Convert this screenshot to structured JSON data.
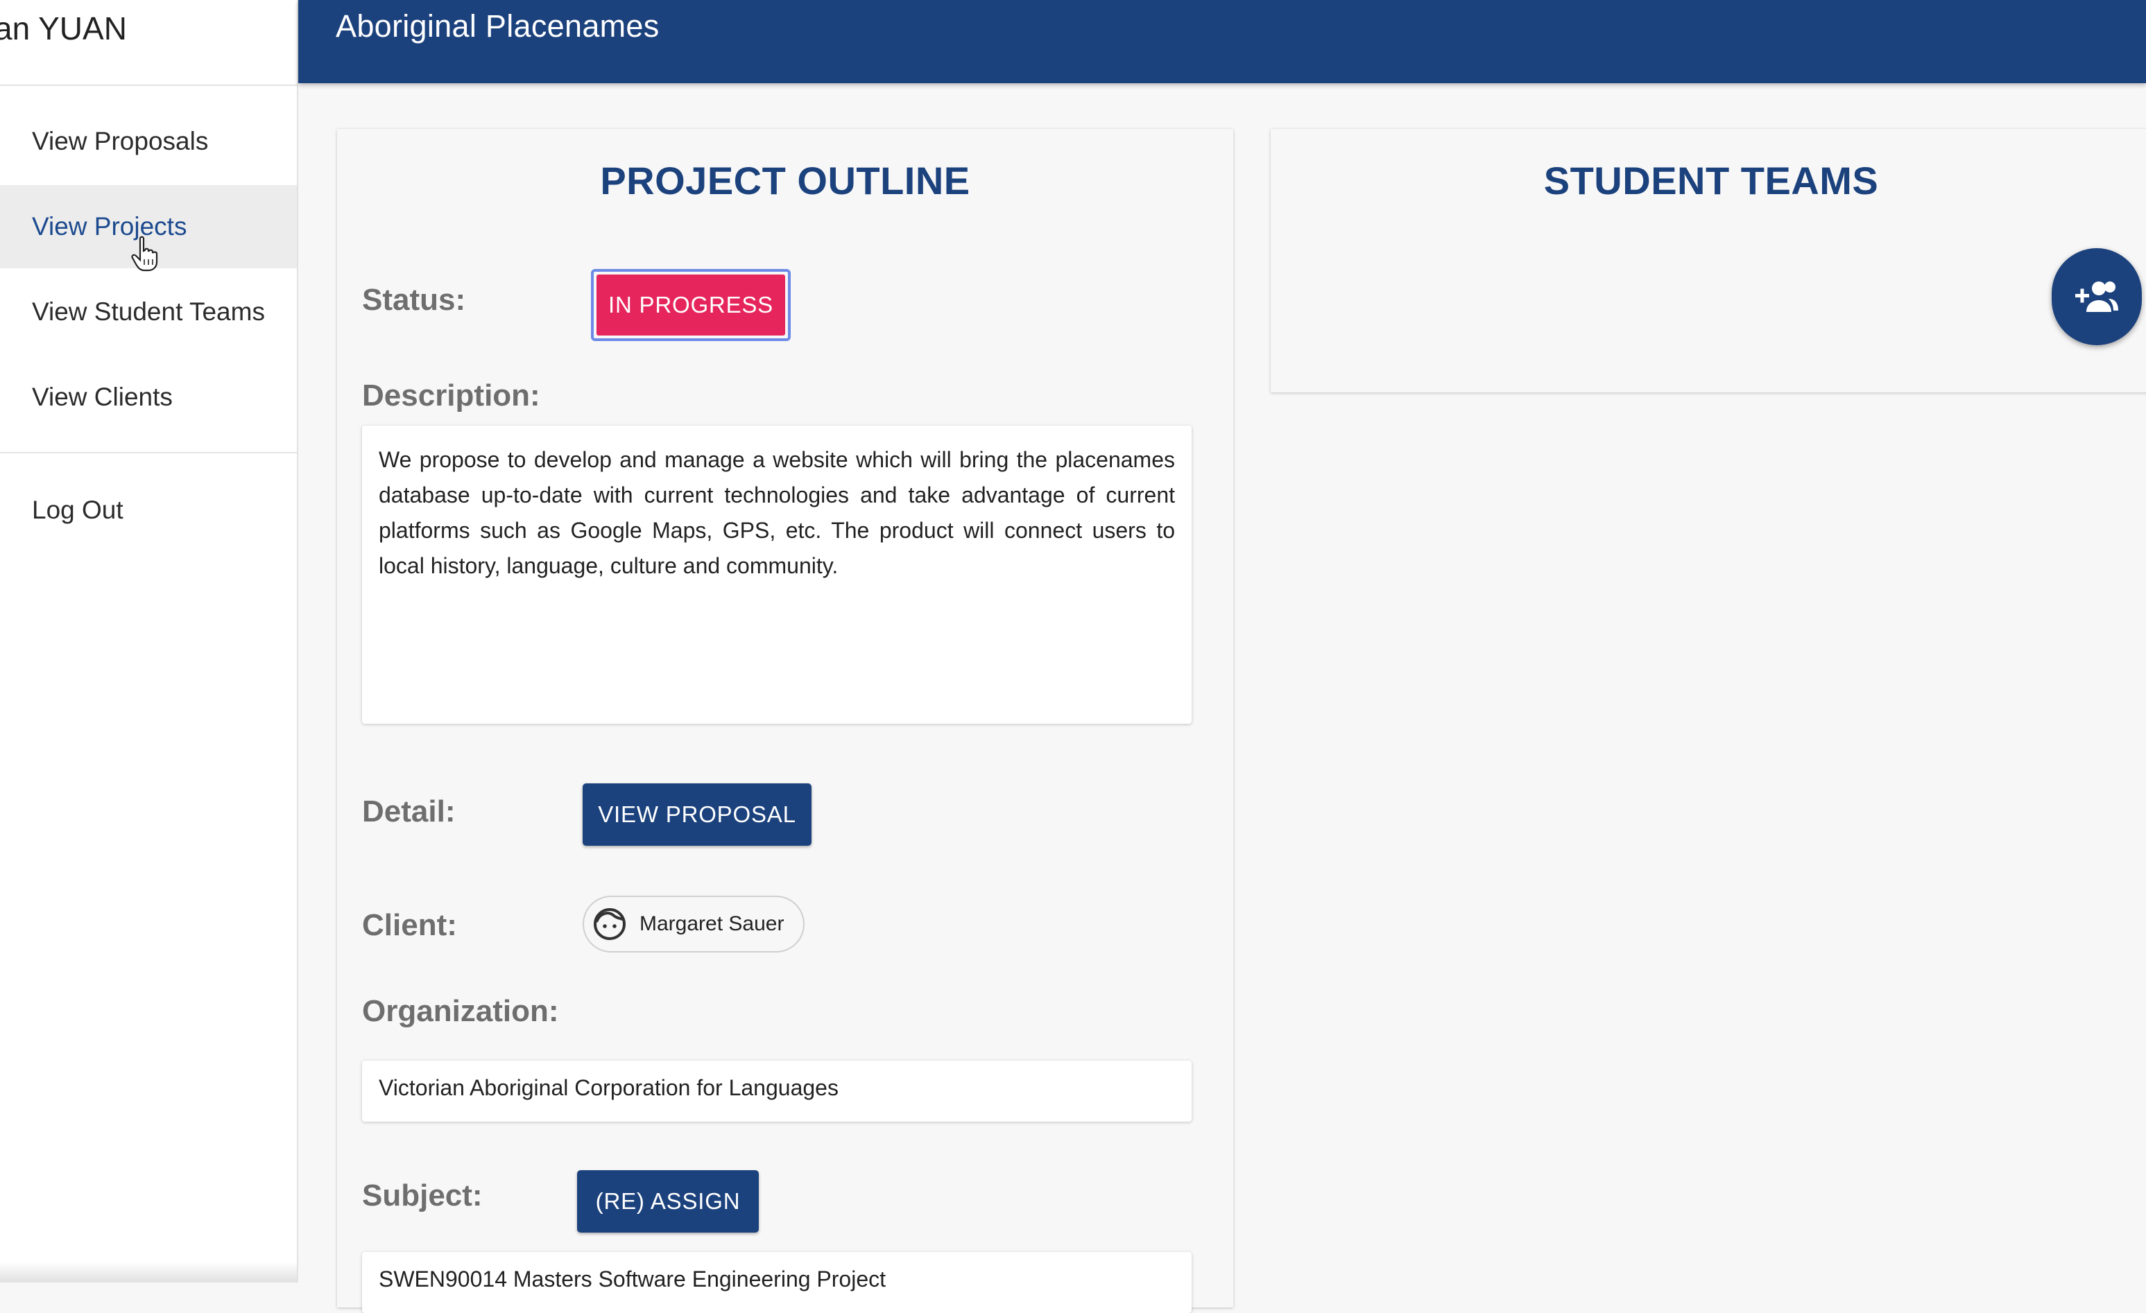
{
  "sidebar": {
    "user_name": "an YUAN",
    "items": [
      {
        "label": "View Proposals"
      },
      {
        "label": "View Projects"
      },
      {
        "label": "View Student Teams"
      },
      {
        "label": "View Clients"
      }
    ],
    "logout_label": "Log Out"
  },
  "header": {
    "title": "Aboriginal Placenames"
  },
  "project_outline": {
    "title": "PROJECT OUTLINE",
    "status_label": "Status:",
    "status_value": "IN PROGRESS",
    "description_label": "Description:",
    "description_text": "We propose to develop and manage a website which will bring the placenames database up-to-date with current technologies and take advantage of current platforms such as Google Maps, GPS, etc. The product will connect users to local history, language, culture and community.",
    "detail_label": "Detail:",
    "view_proposal_button": "VIEW PROPOSAL",
    "client_label": "Client:",
    "client_name": "Margaret Sauer",
    "organization_label": "Organization:",
    "organization_value": "Victorian Aboriginal Corporation for Languages",
    "subject_label": "Subject:",
    "reassign_button": "(RE) ASSIGN",
    "subject_value": "SWEN90014 Masters Software Engineering Project"
  },
  "student_teams": {
    "title": "STUDENT TEAMS",
    "add_team_icon": "group-add-icon"
  },
  "colors": {
    "primary": "#1c427d",
    "status": "#e6255c"
  }
}
